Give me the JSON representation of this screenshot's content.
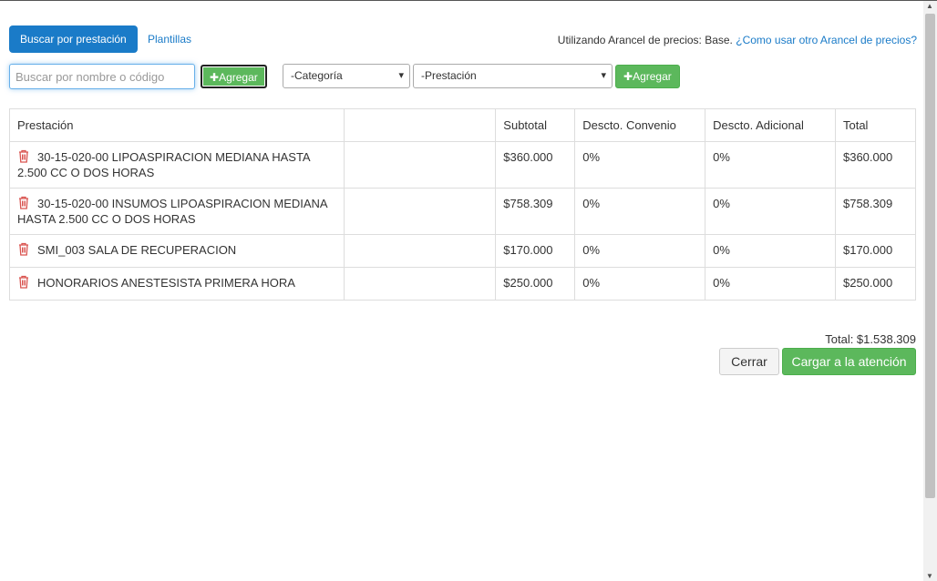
{
  "tabs": {
    "active": "Buscar por prestación",
    "other": "Plantillas"
  },
  "arancel": {
    "prefix": "Utilizando Arancel de precios: Base.",
    "link": "¿Como usar otro Arancel de precios?"
  },
  "search": {
    "placeholder": "Buscar por nombre o código",
    "value": ""
  },
  "add_label": "Agregar",
  "category_select": "-Categoría",
  "prestacion_select": "-Prestación",
  "table": {
    "headers": [
      "Prestación",
      "",
      "Subtotal",
      "Descto. Convenio",
      "Descto. Adicional",
      "Total"
    ],
    "rows": [
      {
        "name": "30-15-020-00 LIPOASPIRACION MEDIANA HASTA 2.500 CC O DOS HORAS",
        "subtotal": "$360.000",
        "convenio": "0%",
        "adicional": "0%",
        "total": "$360.000"
      },
      {
        "name": "30-15-020-00 INSUMOS LIPOASPIRACION MEDIANA HASTA 2.500 CC O DOS HORAS",
        "subtotal": "$758.309",
        "convenio": "0%",
        "adicional": "0%",
        "total": "$758.309"
      },
      {
        "name": "SMI_003 SALA DE RECUPERACION",
        "subtotal": "$170.000",
        "convenio": "0%",
        "adicional": "0%",
        "total": "$170.000"
      },
      {
        "name": "HONORARIOS ANESTESISTA PRIMERA HORA",
        "subtotal": "$250.000",
        "convenio": "0%",
        "adicional": "0%",
        "total": "$250.000"
      }
    ]
  },
  "summary": {
    "total": "Total: $1.538.309"
  },
  "buttons": {
    "close": "Cerrar",
    "load": "Cargar a la atención"
  },
  "icons": {
    "delete": "trash-icon",
    "add": "plus-icon",
    "dropdown": "chevron-down-icon"
  },
  "colors": {
    "primary": "#1a7bc8",
    "success": "#5cb85c",
    "danger": "#d9534f"
  }
}
